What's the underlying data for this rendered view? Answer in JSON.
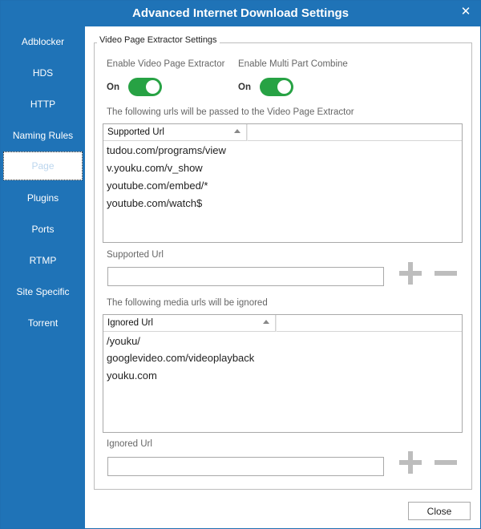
{
  "window": {
    "title": "Advanced Internet Download Settings",
    "close_glyph": "✕"
  },
  "sidebar": {
    "items": [
      {
        "label": "Adblocker"
      },
      {
        "label": "HDS"
      },
      {
        "label": "HTTP"
      },
      {
        "label": "Naming Rules"
      },
      {
        "label": "Page",
        "selected": true
      },
      {
        "label": "Plugins"
      },
      {
        "label": "Ports"
      },
      {
        "label": "RTMP"
      },
      {
        "label": "Site Specific"
      },
      {
        "label": "Torrent"
      }
    ]
  },
  "group": {
    "legend": "Video Page Extractor Settings",
    "enable_extractor": {
      "label": "Enable Video Page Extractor",
      "state": "On",
      "on": true
    },
    "enable_multipart": {
      "label": "Enable Multi Part Combine",
      "state": "On",
      "on": true
    },
    "supported": {
      "caption": "The following urls will be passed to the Video Page Extractor",
      "column": "Supported Url",
      "rows": [
        "tudou.com/programs/view",
        "v.youku.com/v_show",
        "youtube.com/embed/*",
        "youtube.com/watch$"
      ],
      "input_label": "Supported Url",
      "input_value": ""
    },
    "ignored": {
      "caption": "The following media urls will be ignored",
      "column": "Ignored Url",
      "rows": [
        "/youku/",
        "googlevideo.com/videoplayback",
        "youku.com"
      ],
      "input_label": "Ignored Url",
      "input_value": ""
    }
  },
  "footer": {
    "close_label": "Close"
  },
  "colors": {
    "accent": "#1f73b7",
    "toggle_on": "#27a244",
    "button_glyph": "#bdbdbd"
  }
}
